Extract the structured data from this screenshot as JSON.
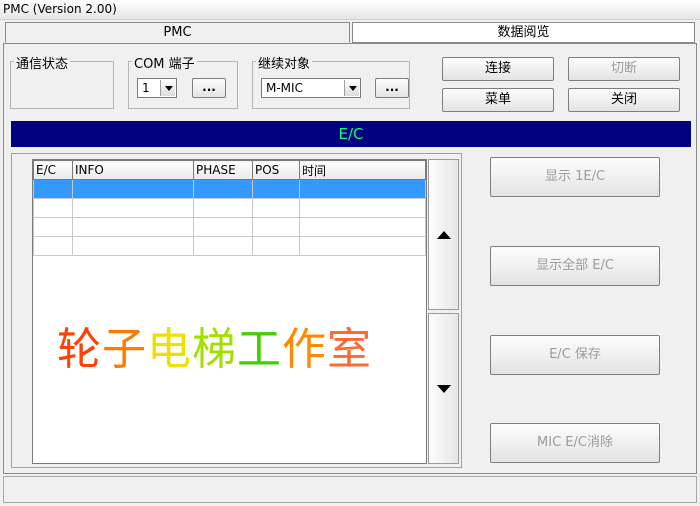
{
  "window": {
    "title": "PMC (Version 2.00)"
  },
  "tabs": [
    {
      "label": "PMC"
    },
    {
      "label": "数据阅览"
    }
  ],
  "comm_status": {
    "label": "通信状态"
  },
  "com_port": {
    "label": "COM 端子",
    "value": "1",
    "more_label": "..."
  },
  "relay_target": {
    "label": "继续对象",
    "value": "M-MIC",
    "more_label": "..."
  },
  "actions": {
    "connect": "连接",
    "switch": "切断",
    "menu": "菜单",
    "close": "关闭"
  },
  "ec_header": "E/C",
  "ec_table": {
    "columns": [
      "E/C",
      "INFO",
      "PHASE",
      "POS",
      "时间"
    ],
    "rows": [
      [
        "",
        "",
        "",
        "",
        ""
      ],
      [
        "",
        "",
        "",
        "",
        ""
      ],
      [
        "",
        "",
        "",
        "",
        ""
      ],
      [
        "",
        "",
        "",
        "",
        ""
      ]
    ],
    "selected_row": 0
  },
  "watermark": {
    "chars": [
      "轮",
      "子",
      "电",
      "梯",
      "工",
      "作",
      "室"
    ],
    "colors": [
      "#ff4000",
      "#ff7a00",
      "#f0e000",
      "#a0e000",
      "#40d000",
      "#ff8a00",
      "#ff6a30"
    ]
  },
  "side_buttons": {
    "show_1ec": "显示 1E/C",
    "show_all_ec": "显示全部 E/C",
    "ec_save": "E/C 保存",
    "mic_ec_clear": "MIC E/C消除"
  },
  "scroll": {
    "up_icon": "triangle-up-icon",
    "down_icon": "triangle-down-icon"
  }
}
